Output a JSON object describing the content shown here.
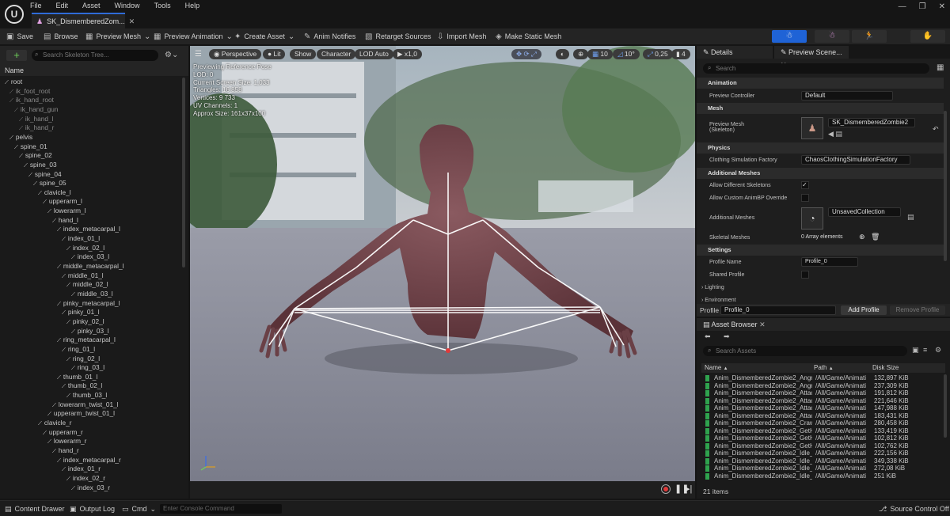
{
  "menu": [
    "File",
    "Edit",
    "Asset",
    "Window",
    "Tools",
    "Help"
  ],
  "tab": {
    "title": "SK_DismemberedZom..."
  },
  "toolbar": {
    "save": "Save",
    "browse": "Browse",
    "preview_mesh": "Preview Mesh",
    "preview_animation": "Preview Animation",
    "create_asset": "Create Asset",
    "anim_notifies": "Anim Notifies",
    "retarget_sources": "Retarget Sources",
    "import_mesh": "Import Mesh",
    "make_static_mesh": "Make Static Mesh"
  },
  "skeleton_tree": {
    "search_placeholder": "Search Skeleton Tree...",
    "column_name": "Name",
    "bones": [
      {
        "name": "root",
        "depth": 0,
        "dim": false
      },
      {
        "name": "ik_foot_root",
        "depth": 1,
        "dim": true
      },
      {
        "name": "ik_hand_root",
        "depth": 1,
        "dim": true
      },
      {
        "name": "ik_hand_gun",
        "depth": 2,
        "dim": true
      },
      {
        "name": "ik_hand_l",
        "depth": 3,
        "dim": true
      },
      {
        "name": "ik_hand_r",
        "depth": 3,
        "dim": true
      },
      {
        "name": "pelvis",
        "depth": 1,
        "dim": false
      },
      {
        "name": "spine_01",
        "depth": 2,
        "dim": false
      },
      {
        "name": "spine_02",
        "depth": 3,
        "dim": false
      },
      {
        "name": "spine_03",
        "depth": 4,
        "dim": false
      },
      {
        "name": "spine_04",
        "depth": 5,
        "dim": false
      },
      {
        "name": "spine_05",
        "depth": 6,
        "dim": false
      },
      {
        "name": "clavicle_l",
        "depth": 7,
        "dim": false
      },
      {
        "name": "upperarm_l",
        "depth": 8,
        "dim": false
      },
      {
        "name": "lowerarm_l",
        "depth": 9,
        "dim": false
      },
      {
        "name": "hand_l",
        "depth": 10,
        "dim": false
      },
      {
        "name": "index_metacarpal_l",
        "depth": 11,
        "dim": false
      },
      {
        "name": "index_01_l",
        "depth": 12,
        "dim": false
      },
      {
        "name": "index_02_l",
        "depth": 13,
        "dim": false
      },
      {
        "name": "index_03_l",
        "depth": 14,
        "dim": false
      },
      {
        "name": "middle_metacarpal_l",
        "depth": 11,
        "dim": false
      },
      {
        "name": "middle_01_l",
        "depth": 12,
        "dim": false
      },
      {
        "name": "middle_02_l",
        "depth": 13,
        "dim": false
      },
      {
        "name": "middle_03_l",
        "depth": 14,
        "dim": false
      },
      {
        "name": "pinky_metacarpal_l",
        "depth": 11,
        "dim": false
      },
      {
        "name": "pinky_01_l",
        "depth": 12,
        "dim": false
      },
      {
        "name": "pinky_02_l",
        "depth": 13,
        "dim": false
      },
      {
        "name": "pinky_03_l",
        "depth": 14,
        "dim": false
      },
      {
        "name": "ring_metacarpal_l",
        "depth": 11,
        "dim": false
      },
      {
        "name": "ring_01_l",
        "depth": 12,
        "dim": false
      },
      {
        "name": "ring_02_l",
        "depth": 13,
        "dim": false
      },
      {
        "name": "ring_03_l",
        "depth": 14,
        "dim": false
      },
      {
        "name": "thumb_01_l",
        "depth": 11,
        "dim": false
      },
      {
        "name": "thumb_02_l",
        "depth": 12,
        "dim": false
      },
      {
        "name": "thumb_03_l",
        "depth": 13,
        "dim": false
      },
      {
        "name": "lowerarm_twist_01_l",
        "depth": 10,
        "dim": false
      },
      {
        "name": "upperarm_twist_01_l",
        "depth": 9,
        "dim": false
      },
      {
        "name": "clavicle_r",
        "depth": 7,
        "dim": false
      },
      {
        "name": "upperarm_r",
        "depth": 8,
        "dim": false
      },
      {
        "name": "lowerarm_r",
        "depth": 9,
        "dim": false
      },
      {
        "name": "hand_r",
        "depth": 10,
        "dim": false
      },
      {
        "name": "index_metacarpal_r",
        "depth": 11,
        "dim": false
      },
      {
        "name": "index_01_r",
        "depth": 12,
        "dim": false
      },
      {
        "name": "index_02_r",
        "depth": 13,
        "dim": false
      },
      {
        "name": "index_03_r",
        "depth": 14,
        "dim": false
      }
    ]
  },
  "viewport": {
    "perspective": "Perspective",
    "lit": "Lit",
    "show": "Show",
    "character": "Character",
    "lod": "LOD Auto",
    "speed": "x1,0",
    "grid": "10",
    "angle": "10°",
    "scale": "0,25",
    "camera": "4",
    "stats": [
      "Previewing Reference Pose",
      "LOD: 0",
      "Current Screen Size: 1,033",
      "Triangles: 16 858",
      "Vertices: 9 733",
      "UV Channels: 1",
      "Approx Size: 161x37x100"
    ]
  },
  "details": {
    "tab_details": "Details",
    "tab_preview": "Preview Scene...",
    "search_placeholder": "Search",
    "cat_animation": "Animation",
    "preview_controller_label": "Preview Controller",
    "preview_controller_value": "Default",
    "cat_mesh": "Mesh",
    "preview_mesh_label": "Preview Mesh",
    "preview_mesh_sub": "(Skeleton)",
    "preview_mesh_value": "SK_DismemberedZombie2",
    "cat_physics": "Physics",
    "clothing_label": "Clothing Simulation Factory",
    "clothing_value": "ChaosClothingSimulationFactory",
    "cat_additional": "Additional Meshes",
    "allow_diff_label": "Allow Different Skeletons",
    "allow_custom_label": "Allow Custom AnimBP Override",
    "additional_label": "Additional Meshes",
    "additional_value": "UnsavedCollection",
    "skeletal_label": "Skeletal Meshes",
    "skeletal_value": "0 Array elements",
    "cat_settings": "Settings",
    "profile_name_label": "Profile Name",
    "profile_name_value": "Profile_0",
    "shared_profile_label": "Shared Profile",
    "lighting": "Lighting",
    "environment": "Environment",
    "profile_label": "Profile",
    "profile_value": "Profile_0",
    "add_profile": "Add Profile",
    "remove_profile": "Remove Profile"
  },
  "asset_browser": {
    "title": "Asset Browser",
    "search_placeholder": "Search Assets",
    "col_name": "Name",
    "col_path": "Path",
    "col_size": "Disk Size",
    "rows": [
      {
        "name": "Anim_DismemberedZombie2_Angry",
        "path": "/All/Game/Animati",
        "size": "132,897 KiB"
      },
      {
        "name": "Anim_DismemberedZombie2_Angry",
        "path": "/All/Game/Animati",
        "size": "237,309 KiB"
      },
      {
        "name": "Anim_DismemberedZombie2_Attack",
        "path": "/All/Game/Animati",
        "size": "191,812 KiB"
      },
      {
        "name": "Anim_DismemberedZombie2_Attack",
        "path": "/All/Game/Animati",
        "size": "221,646 KiB"
      },
      {
        "name": "Anim_DismemberedZombie2_Attack",
        "path": "/All/Game/Animati",
        "size": "147,988 KiB"
      },
      {
        "name": "Anim_DismemberedZombie2_Attack",
        "path": "/All/Game/Animati",
        "size": "183,431 KiB"
      },
      {
        "name": "Anim_DismemberedZombie2_Crawl",
        "path": "/All/Game/Animati",
        "size": "280,458 KiB"
      },
      {
        "name": "Anim_DismemberedZombie2_GetHit",
        "path": "/All/Game/Animati",
        "size": "133,419 KiB"
      },
      {
        "name": "Anim_DismemberedZombie2_GetHit",
        "path": "/All/Game/Animati",
        "size": "102,812 KiB"
      },
      {
        "name": "Anim_DismemberedZombie2_GetHit",
        "path": "/All/Game/Animati",
        "size": "102,762 KiB"
      },
      {
        "name": "Anim_DismemberedZombie2_Idle_",
        "path": "/All/Game/Animati",
        "size": "222,156 KiB"
      },
      {
        "name": "Anim_DismemberedZombie2_Idle_",
        "path": "/All/Game/Animati",
        "size": "349,338 KiB"
      },
      {
        "name": "Anim_DismemberedZombie2_Idle_",
        "path": "/All/Game/Animati",
        "size": "272,08 KiB"
      },
      {
        "name": "Anim_DismemberedZombie2_Idle_",
        "path": "/All/Game/Animati",
        "size": "251 KiB"
      }
    ],
    "item_count": "21 items"
  },
  "status": {
    "content_drawer": "Content Drawer",
    "output_log": "Output Log",
    "cmd": "Cmd",
    "console_placeholder": "Enter Console Command",
    "source_control": "Source Control Off"
  },
  "colors": {
    "accent": "#2f6bd8",
    "asset_green": "#2fa34e"
  }
}
